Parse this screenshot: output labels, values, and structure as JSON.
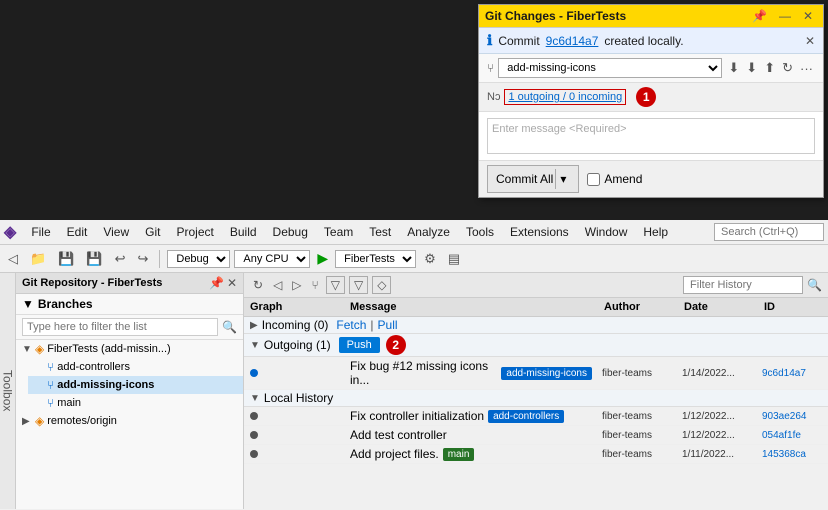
{
  "gitChangesPanel": {
    "title": "Git Changes - FiberTests",
    "infoBar": {
      "text": "Commit ",
      "commitHash": "9c6d14a7",
      "suffix": " created locally."
    },
    "branch": "add-missing-icons",
    "outgoing": "1 outgoing / 0 incoming",
    "messagePlaceholder": "Enter message <Required>",
    "commitAllLabel": "Commit All",
    "amendLabel": "Amend",
    "badge1": "1"
  },
  "menuBar": {
    "logoSymbol": "◈",
    "items": [
      "File",
      "Edit",
      "View",
      "Git",
      "Project",
      "Build",
      "Debug",
      "Team",
      "Test",
      "Analyze",
      "Tools",
      "Extensions",
      "Window",
      "Help"
    ],
    "searchPlaceholder": "Search (Ctrl+Q)"
  },
  "toolbar": {
    "config": "Debug",
    "platform": "Any CPU",
    "project": "FiberTests",
    "runSymbol": "▶"
  },
  "toolbox": {
    "label": "Toolbox"
  },
  "repoPanel": {
    "title": "Git Repository - FiberTests",
    "branchesHeader": "Branches",
    "filterPlaceholder": "Type here to filter the list",
    "tree": [
      {
        "level": 0,
        "type": "root",
        "label": "FiberTests (add-missin...)",
        "icon": "◈",
        "iconColor": "orange",
        "expanded": true
      },
      {
        "level": 1,
        "type": "branch",
        "label": "add-controllers",
        "icon": "⑂"
      },
      {
        "level": 1,
        "type": "branch",
        "label": "add-missing-icons",
        "icon": "⑂",
        "bold": true
      },
      {
        "level": 1,
        "type": "branch",
        "label": "main",
        "icon": "⑂"
      },
      {
        "level": 0,
        "type": "folder",
        "label": "remotes/origin",
        "icon": "◈",
        "iconColor": "orange",
        "expanded": false
      }
    ]
  },
  "commitPanel": {
    "filterPlaceholder": "Filter History",
    "columns": {
      "graph": "Graph",
      "message": "Message",
      "author": "Author",
      "date": "Date",
      "id": "ID"
    },
    "sections": [
      {
        "type": "section",
        "label": "Incoming (0)",
        "fetchLabel": "Fetch",
        "pullLabel": "Pull",
        "expanded": false
      },
      {
        "type": "section",
        "label": "Outgoing (1)",
        "pushLabel": "Push",
        "expanded": true
      }
    ],
    "outgoingCommit": {
      "graph": "",
      "message": "Fix bug #12 missing icons in...",
      "tag": "add-missing-icons",
      "tagColor": "blue",
      "author": "fiber-teams",
      "date": "1/14/2022...",
      "id": "9c6d14a7"
    },
    "localHistoryHeader": "Local History",
    "localCommits": [
      {
        "message": "Fix controller initialization",
        "tag": "add-controllers",
        "tagColor": "blue",
        "author": "fiber-teams",
        "date": "1/12/2022...",
        "id": "903ae264"
      },
      {
        "message": "Add test controller",
        "tag": null,
        "author": "fiber-teams",
        "date": "1/12/2022...",
        "id": "054af1fe"
      },
      {
        "message": "Add project files.",
        "tag": "main",
        "tagColor": "green",
        "author": "fiber-teams",
        "date": "1/11/2022...",
        "id": "145368ca"
      }
    ],
    "badge2": "2"
  }
}
